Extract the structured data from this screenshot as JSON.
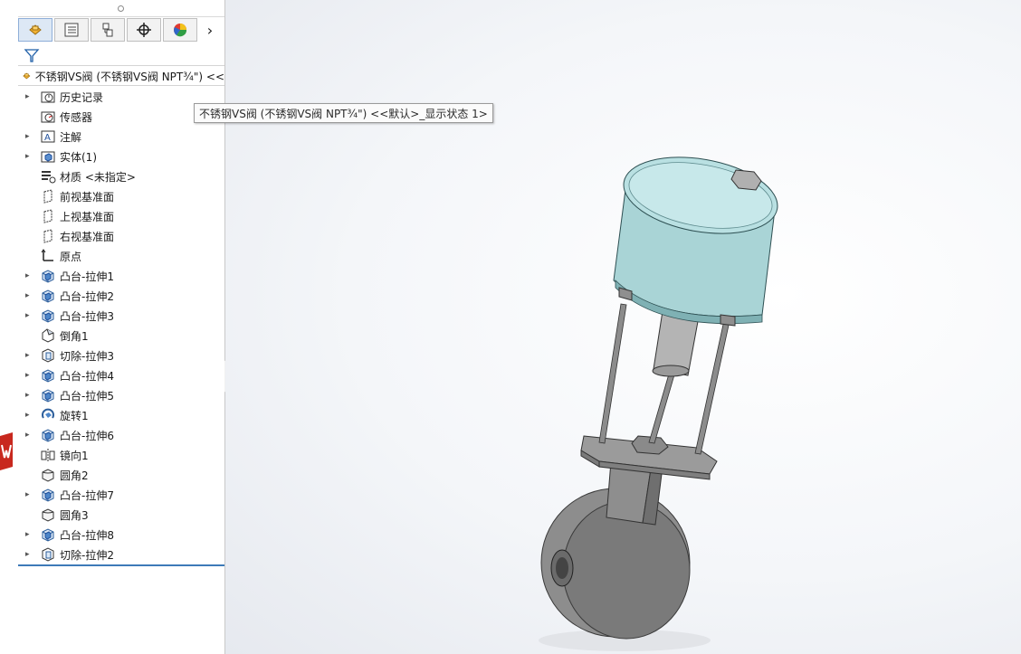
{
  "feature_tree": {
    "tabs": [
      {
        "icon": "feature-manager-icon"
      },
      {
        "icon": "property-manager-icon"
      },
      {
        "icon": "configuration-manager-icon"
      },
      {
        "icon": "dimxpert-icon"
      },
      {
        "icon": "display-manager-icon"
      }
    ],
    "root_label": "不锈钢VS阀 (不锈钢VS阀 NPT¾\") <<",
    "items": [
      {
        "label": "历史记录",
        "icon": "history-folder-icon",
        "expandable": true
      },
      {
        "label": "传感器",
        "icon": "sensors-folder-icon",
        "expandable": false
      },
      {
        "label": "注解",
        "icon": "annotations-folder-icon",
        "expandable": true
      },
      {
        "label": "实体(1)",
        "icon": "solid-bodies-folder-icon",
        "expandable": true
      },
      {
        "label": "材质 <未指定>",
        "icon": "material-icon",
        "expandable": false
      },
      {
        "label": "前视基准面",
        "icon": "plane-icon",
        "expandable": false
      },
      {
        "label": "上视基准面",
        "icon": "plane-icon",
        "expandable": false
      },
      {
        "label": "右视基准面",
        "icon": "plane-icon",
        "expandable": false
      },
      {
        "label": "原点",
        "icon": "origin-icon",
        "expandable": false
      },
      {
        "label": "凸台-拉伸1",
        "icon": "boss-extrude-icon",
        "expandable": true
      },
      {
        "label": "凸台-拉伸2",
        "icon": "boss-extrude-icon",
        "expandable": true
      },
      {
        "label": "凸台-拉伸3",
        "icon": "boss-extrude-icon",
        "expandable": true
      },
      {
        "label": "倒角1",
        "icon": "chamfer-icon",
        "expandable": false
      },
      {
        "label": "切除-拉伸3",
        "icon": "cut-extrude-icon",
        "expandable": true
      },
      {
        "label": "凸台-拉伸4",
        "icon": "boss-extrude-icon",
        "expandable": true
      },
      {
        "label": "凸台-拉伸5",
        "icon": "boss-extrude-icon",
        "expandable": true
      },
      {
        "label": "旋转1",
        "icon": "revolve-icon",
        "expandable": true
      },
      {
        "label": "凸台-拉伸6",
        "icon": "boss-extrude-icon",
        "expandable": true
      },
      {
        "label": "镜向1",
        "icon": "mirror-icon",
        "expandable": false
      },
      {
        "label": "圆角2",
        "icon": "fillet-icon",
        "expandable": false
      },
      {
        "label": "凸台-拉伸7",
        "icon": "boss-extrude-icon",
        "expandable": true
      },
      {
        "label": "圆角3",
        "icon": "fillet-icon",
        "expandable": false
      },
      {
        "label": "凸台-拉伸8",
        "icon": "boss-extrude-icon",
        "expandable": true
      },
      {
        "label": "切除-拉伸2",
        "icon": "cut-extrude-icon",
        "expandable": true
      }
    ]
  },
  "tooltip": {
    "text": "不锈钢VS阀 (不锈钢VS阀 NPT¾\") <<默认>_显示状态 1>"
  },
  "colors": {
    "selection_line": "#3d7ab8",
    "actuator_teal": "#a9d4d6",
    "model_gray": "#9a9a9a"
  }
}
